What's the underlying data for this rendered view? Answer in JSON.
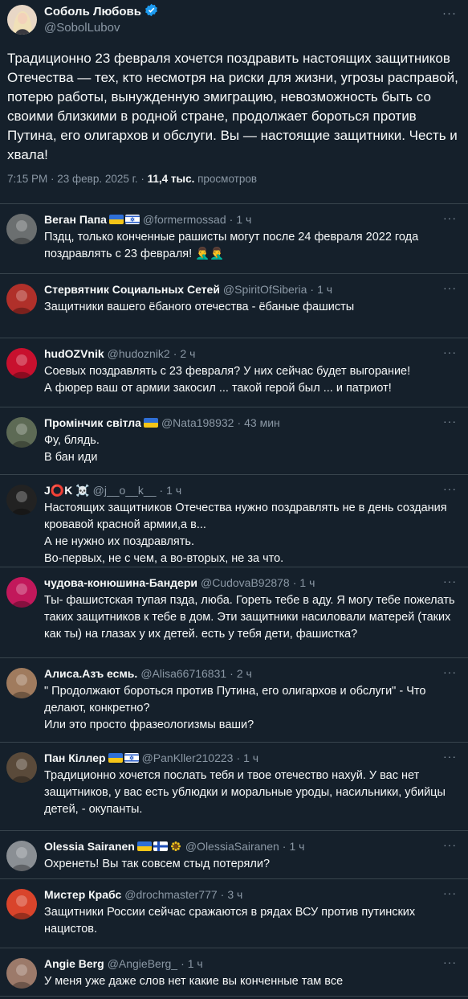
{
  "main": {
    "name": "Соболь Любовь",
    "handle": "@SobolLubov",
    "more": "···",
    "text": "Традиционно 23 февраля хочется поздравить настоящих защитников Отечества — тех, кто несмотря на риски для жизни, угрозы расправой, потерю работы, вынужденную эмиграцию, невозможность быть со своими близкими в родной стране, продолжает бороться против Путина, его олигархов и обслуги. Вы — настоящие защитники. Честь и хвала!",
    "time": "7:15 PM · 23 февр. 2025 г. · ",
    "views_count": "11,4 тыс.",
    "views_label": "просмотров"
  },
  "replies": [
    {
      "name": "Веган Папа",
      "flags": [
        "ua",
        "il"
      ],
      "handle": "@formermossad",
      "time": "1 ч",
      "text": "Пздц, только конченные рашисты могут после 24 февраля 2022 года поздравлять с 23 февраля! 🤦‍♂️🤦‍♂️",
      "avatar": "#6b6f70"
    },
    {
      "name": "Стервятник Социальных Сетей",
      "flags": [],
      "handle": "@SpiritOfSiberia",
      "time": "1 ч",
      "text": "Защитники вашего ёбаного отечества - ёбаные фашисты",
      "avatar": "#b0302a"
    },
    {
      "name": "hudOZVnik",
      "flags": [],
      "handle": "@hudoznik2",
      "time": "2 ч",
      "text": "Соевых поздравлять с 23 февраля? У них сейчас будет выгорание!\nА фюрер  ваш от армии закосил ... такой герой был ... и патриот!",
      "avatar": "#c8102e"
    },
    {
      "name": "Промінчик світла",
      "flags": [
        "ua"
      ],
      "handle": "@Nata198932",
      "time": "43 мин",
      "text": "Фу, блядь.\nВ бан иди",
      "avatar": "#5d6a55"
    },
    {
      "name": "J⭕K ☠️",
      "flags": [],
      "handle": "@j__o__k__",
      "time": "1 ч",
      "text": "Настоящих защитников Отечества нужно поздравлять не в день создания кровавой красной армии,а в...\nА не нужно их поздравлять.\nВо-первых, не с чем, а во-вторых, не за что.",
      "avatar": "#222222"
    },
    {
      "name": "чудова-конюшина-Бандери",
      "flags": [],
      "handle": "@CudovaB92878",
      "time": "1 ч",
      "text": "Ты- фашистская тупая пзда, люба. Гореть тебе в аду. Я могу тебе пожелать таких защитников к тебе в дом. Эти защитники насиловали матерей (таких как ты) на глазах у их детей. есть у тебя дети, фашистка?",
      "avatar": "#c2185b"
    },
    {
      "name": "Алиса.Азъ есмь.",
      "flags": [],
      "handle": "@Alisa66716831",
      "time": "2 ч",
      "text": "\" Продолжают бороться против Путина,  его олигархов и обслуги\" - Что делают, конкретно?\n Или это просто фразеологизмы ваши?",
      "avatar": "#a07b5e"
    },
    {
      "name": "Пан Кіллер",
      "flags": [
        "ua",
        "il"
      ],
      "handle": "@PanKller210223",
      "time": "1 ч",
      "text": "Традиционно хочется послать тебя и твое отечество нахуй. У вас нет защитников, у вас есть ублюдки и моральные уроды, насильники, убийцы детей, - окупанты.",
      "avatar": "#5a4a3a"
    },
    {
      "name": "Olessia Sairanen",
      "flags": [
        "ua",
        "fi",
        "sun"
      ],
      "handle": "@OlessiaSairanen",
      "time": "1 ч",
      "text": "Охренеть! Вы так совсем стыд потеряли?",
      "avatar": "#8a8f94"
    },
    {
      "name": "Мистер Крабс",
      "flags": [],
      "handle": "@drochmaster777",
      "time": "3 ч",
      "text": "Защитники России сейчас сражаются в рядах ВСУ против путинских нацистов.",
      "avatar": "#d9442b"
    },
    {
      "name": "Angie Berg",
      "flags": [],
      "handle": "@AngieBerg_",
      "time": "1 ч",
      "text": "У меня уже даже слов нет какие вы конченные там все",
      "avatar": "#9c7a6a"
    }
  ],
  "colors": {
    "background": "#15202b",
    "secondary_text": "#8b98a5",
    "verified": "#1d9bf0",
    "divider": "#38444d"
  }
}
